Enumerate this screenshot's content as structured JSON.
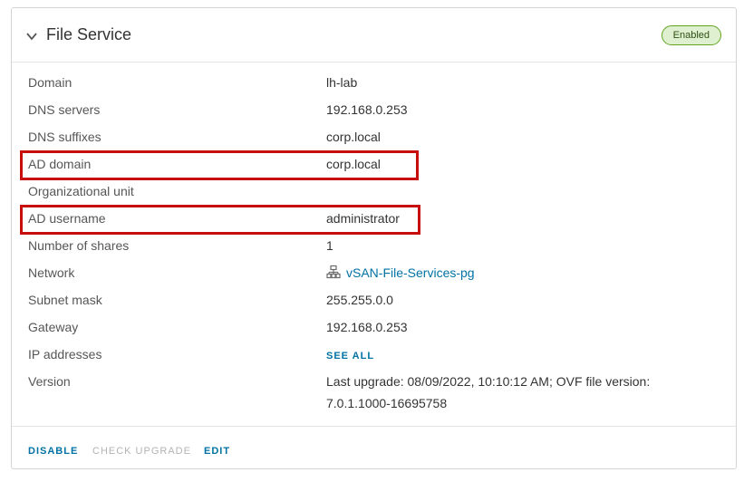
{
  "card": {
    "title": "File Service",
    "status_badge": "Enabled",
    "rows": [
      {
        "label": "Domain",
        "value": "lh-lab"
      },
      {
        "label": "DNS servers",
        "value": "192.168.0.253"
      },
      {
        "label": "DNS suffixes",
        "value": "corp.local"
      },
      {
        "label": "AD domain",
        "value": "corp.local"
      },
      {
        "label": "Organizational unit",
        "value": ""
      },
      {
        "label": "AD username",
        "value": "administrator"
      },
      {
        "label": "Number of shares",
        "value": "1"
      },
      {
        "label": "Network",
        "value": "vSAN-File-Services-pg",
        "icon": "network-icon"
      },
      {
        "label": "Subnet mask",
        "value": "255.255.0.0"
      },
      {
        "label": "Gateway",
        "value": "192.168.0.253"
      },
      {
        "label": "IP addresses",
        "value": "SEE ALL"
      },
      {
        "label": "Version",
        "value": "Last upgrade: 08/09/2022, 10:10:12 AM; OVF file version: 7.0.1.1000-16695758"
      }
    ],
    "highlighted_rows": [
      "AD domain",
      "AD username"
    ]
  },
  "footer": {
    "disable_label": "DISABLE",
    "check_upgrade_label": "CHECK UPGRADE",
    "edit_label": "EDIT"
  },
  "colors": {
    "accent": "#0072a3",
    "badge_bg": "#dff0d0",
    "badge_border": "#62a420",
    "highlight": "#c80d0d"
  }
}
